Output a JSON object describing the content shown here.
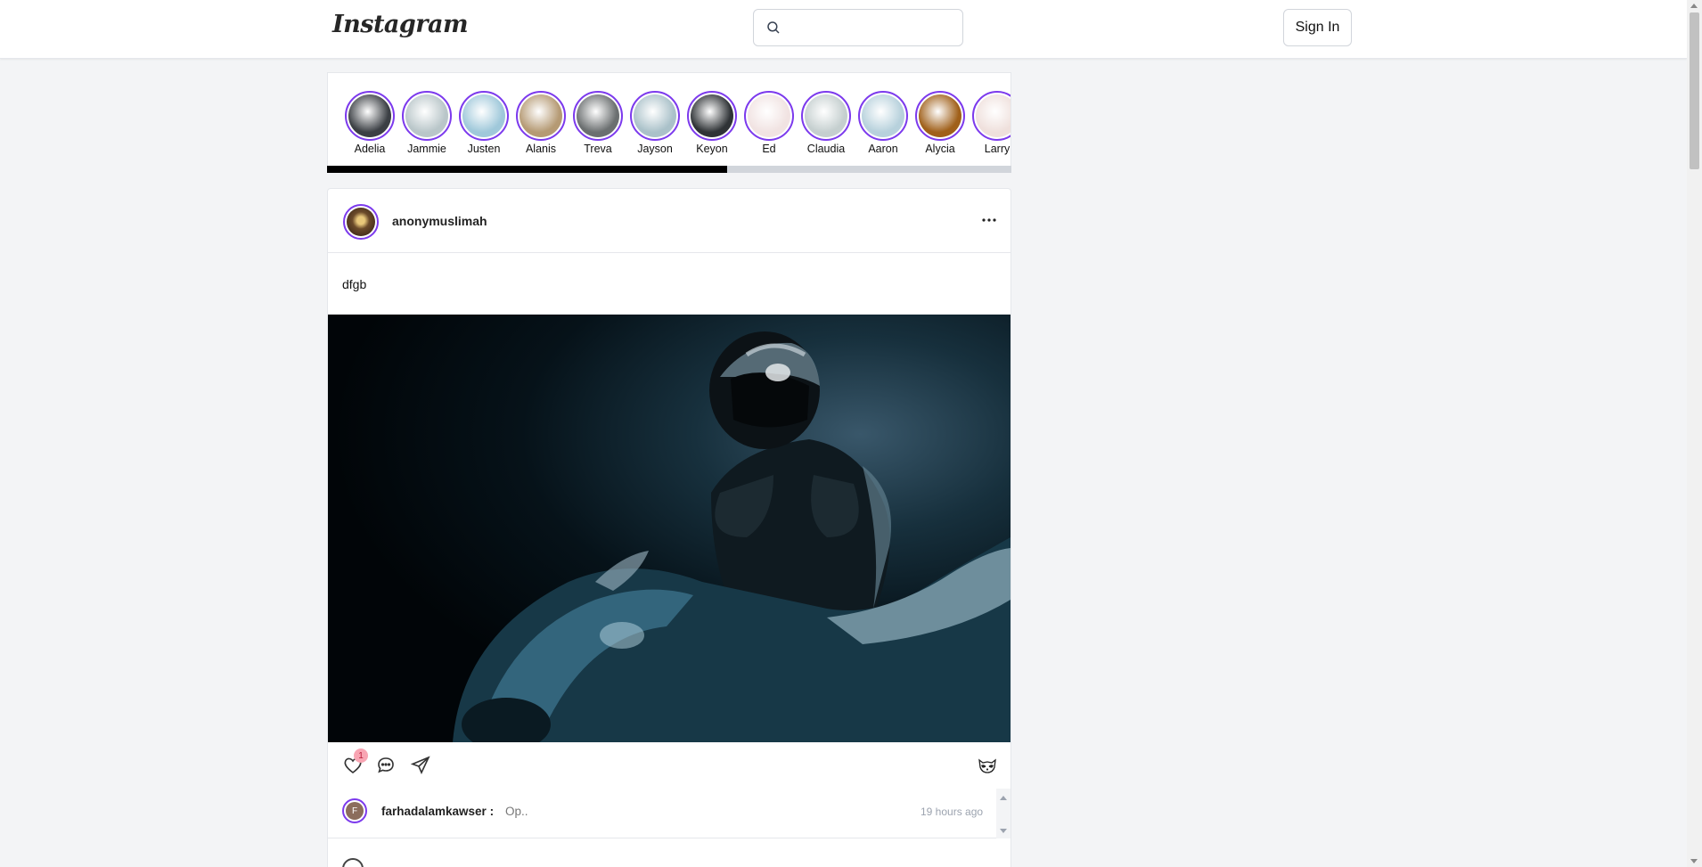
{
  "header": {
    "logo": "Instagram",
    "search_placeholder": "",
    "search_value": "",
    "sign_in_label": "Sign In"
  },
  "stories": {
    "items": [
      {
        "name": "Adelia",
        "color": "#3b3f44"
      },
      {
        "name": "Jammie",
        "color": "#b9c6c9"
      },
      {
        "name": "Justen",
        "color": "#9fc8da"
      },
      {
        "name": "Alanis",
        "color": "#b59a74"
      },
      {
        "name": "Treva",
        "color": "#6b6f70"
      },
      {
        "name": "Jayson",
        "color": "#aac1c9"
      },
      {
        "name": "Keyon",
        "color": "#2f3336"
      },
      {
        "name": "Ed",
        "color": "#f1e3e2"
      },
      {
        "name": "Claudia",
        "color": "#c5cfcf"
      },
      {
        "name": "Aaron",
        "color": "#b7d1dc"
      },
      {
        "name": "Alycia",
        "color": "#a0601a"
      },
      {
        "name": "Larry",
        "color": "#efe0dc"
      }
    ],
    "scroll_progress": 0.585
  },
  "post": {
    "username": "anonymuslimah",
    "caption": "dfgb",
    "likes_count": "1",
    "comments": [
      {
        "avatar_letter": "F",
        "username": "farhadalamkawser :",
        "text": "Op..",
        "time": "19 hours ago"
      }
    ]
  },
  "colors": {
    "accent": "#7c3aed",
    "page_bg": "#f3f4f6",
    "badge_bg": "#f8a5b3"
  },
  "icons": [
    "search-icon",
    "more-icon",
    "heart-icon",
    "comment-icon",
    "share-icon",
    "raccoon-icon"
  ]
}
